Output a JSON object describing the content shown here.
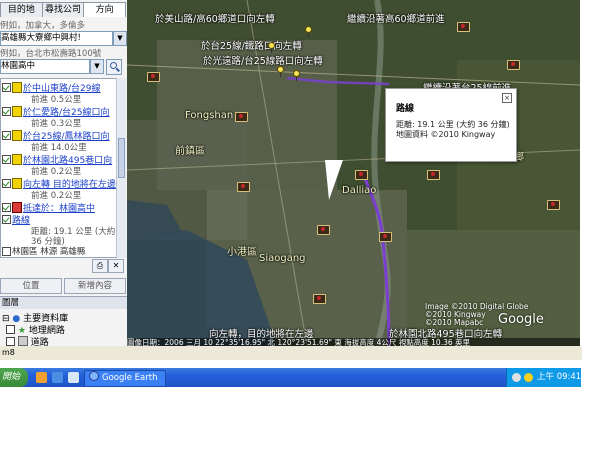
{
  "left_panel": {
    "tabs": [
      {
        "label": "目的地"
      },
      {
        "label": "尋找公司"
      },
      {
        "label": "方向"
      }
    ],
    "from_hint": "例如，加拿大，多倫多",
    "from_value": "高雄縣大寮鄉中興村!",
    "to_hint": "例如，台北市松壽路100號",
    "to_value": "林園高中",
    "route_steps": [
      {
        "text": "於中山東路/台29線",
        "sub": "前進 0.5公里",
        "icon": "yellow"
      },
      {
        "text": "於仁愛路/台25線口向",
        "sub": "前進 0.3公里",
        "icon": "yellow"
      },
      {
        "text": "於台25線/鳳林路口向",
        "sub": "前進 14.0公里",
        "icon": "yellow"
      },
      {
        "text": "於林園北路495巷口向",
        "sub": "前進 0.2公里",
        "icon": "yellow"
      },
      {
        "text": "向左轉 目的地將在左邊",
        "sub": "前進 0.2公里",
        "icon": "yellow"
      },
      {
        "text": "抵達於：林園高中",
        "sub": "",
        "icon": "flag"
      }
    ],
    "route_item": {
      "text": "路線",
      "sub1": "距離: 19.1 公里 (大約",
      "sub2": "36 分鐘)"
    },
    "truncated_row": "林園區 林源 高雄縣",
    "position_button": "位置",
    "add_content_button": "新增內容",
    "layers_header": "圖層",
    "layers": [
      {
        "label": "主要資料庫"
      },
      {
        "label": "地理網路"
      },
      {
        "label": "道路"
      }
    ]
  },
  "map": {
    "labels": [
      "於美山路/高60鄉道口向左轉",
      "繼續沿著高60鄉道前進",
      "於台25線/鐵路口向左轉",
      "於光遠路/台25線路口向左轉",
      "繼續沿著台25線前進",
      "Fongshan",
      "前鎮區",
      "萬丹鄉",
      "Dalliao",
      "小港區",
      "Siaogang",
      "向左轉，目的地將在左邊",
      "於林園北路495巷口向左轉"
    ],
    "balloon": {
      "title": "路線",
      "line1": "距離: 19.1 公里 (大約 36 分鐘)",
      "line2": "地圖資料 ©2010 Kingway"
    },
    "copyright": [
      "Image ©2010 Digital Globe",
      "©2010 Kingway",
      "©2010 Mapabc"
    ],
    "logo": "Google",
    "status_bar": "圖像日期：2006 三月 10    22°35'16.95\" 北    120°23'51.69\" 東 海拔高度 4公尺    視點高度 10.36 英里"
  },
  "app_status": "m8",
  "taskbar": {
    "start_label": "開始",
    "task_label": "Google Earth",
    "clock": "上午 09:41"
  },
  "colors": {
    "taskbar_blue": "#245edb",
    "link_blue": "#1a3fc8",
    "route_purple": "#7a3fd0"
  }
}
